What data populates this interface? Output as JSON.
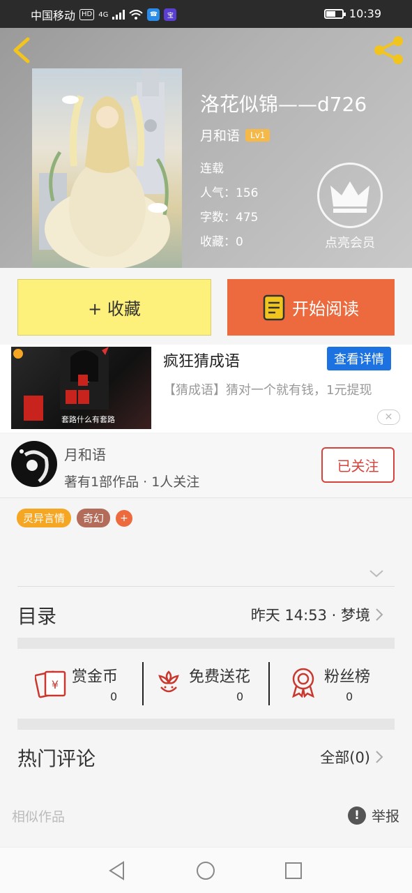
{
  "status_bar": {
    "carrier": "中国移动",
    "hd": "HD",
    "network": "4G",
    "time": "10:39",
    "battery_level": 0.6
  },
  "book": {
    "title": "洛花似锦——d726",
    "author": "月和语",
    "level": "Lv1",
    "status": "连载",
    "popularity_label": "人气",
    "popularity": "156",
    "words_label": "字数",
    "words": "475",
    "favorites_label": "收藏",
    "favorites": "0",
    "vip_label": "点亮会员"
  },
  "actions": {
    "collect": "+ 收藏",
    "read": "开始阅读"
  },
  "ad": {
    "title": "疯狂猜成语",
    "detail_button": "查看详情",
    "description": "【猜成语】猜对一个就有钱，1元提现",
    "thumb_caption": "套路什么有套路"
  },
  "author_card": {
    "name": "月和语",
    "stats": "著有1部作品 · 1人关注",
    "follow_button": "已关注"
  },
  "tags": [
    {
      "label": "灵异言情",
      "color": "#f5a623"
    },
    {
      "label": "奇幻",
      "color": "#b36c5a"
    }
  ],
  "tag_add": "+",
  "toc": {
    "label": "目录",
    "latest": "昨天 14:53 · 梦境"
  },
  "stats": [
    {
      "label": "赏金币",
      "value": "0",
      "icon": "coin-envelope-icon"
    },
    {
      "label": "免费送花",
      "value": "0",
      "icon": "flower-icon"
    },
    {
      "label": "粉丝榜",
      "value": "0",
      "icon": "medal-icon"
    }
  ],
  "comments": {
    "label": "热门评论",
    "all": "全部(0)"
  },
  "similar": {
    "label": "相似作品",
    "report": "举报"
  },
  "colors": {
    "accent_orange": "#ec6a3d",
    "collect_yellow": "#fdf07b",
    "ad_blue": "#1c72e0",
    "follow_red": "#d6433b",
    "icon_red": "#c9382f"
  }
}
